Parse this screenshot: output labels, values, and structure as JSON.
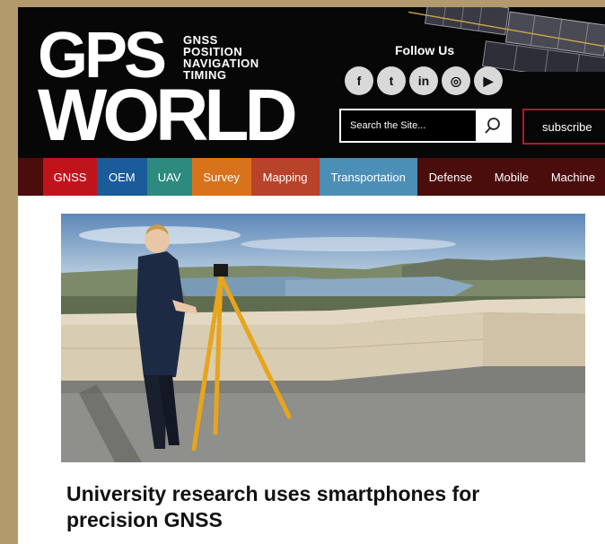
{
  "brand": {
    "logo_line1": "GPS",
    "logo_line2": "WORLD",
    "tagline": [
      "GNSS",
      "POSITION",
      "NAVIGATION",
      "TIMING"
    ]
  },
  "social": {
    "label": "Follow Us",
    "icons": [
      {
        "name": "facebook-icon",
        "glyph": "f"
      },
      {
        "name": "twitter-icon",
        "glyph": "t"
      },
      {
        "name": "linkedin-icon",
        "glyph": "in"
      },
      {
        "name": "rss-icon",
        "glyph": "◎"
      },
      {
        "name": "youtube-icon",
        "glyph": "▶"
      }
    ]
  },
  "search": {
    "placeholder": "Search the Site..."
  },
  "subscribe_label": "subscribe",
  "nav": [
    {
      "label": "GNSS",
      "color": "#c0141d"
    },
    {
      "label": "OEM",
      "color": "#1a5b9a"
    },
    {
      "label": "UAV",
      "color": "#2d8a7f"
    },
    {
      "label": "Survey",
      "color": "#d9731b"
    },
    {
      "label": "Mapping",
      "color": "#b8422a"
    },
    {
      "label": "Transportation",
      "color": "#4c8fb6"
    },
    {
      "label": "Defense",
      "color": "#4b0c0c"
    },
    {
      "label": "Mobile",
      "color": "#4b0c0c"
    },
    {
      "label": "Machine",
      "color": "#4b0c0c"
    }
  ],
  "article": {
    "headline": "University research uses smartphones for precision GNSS"
  }
}
